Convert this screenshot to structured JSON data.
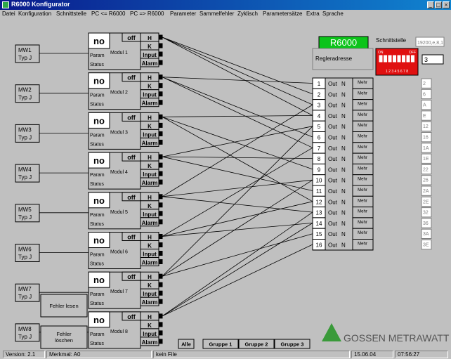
{
  "window": {
    "title": "R6000 Konfigurator"
  },
  "menu": [
    "Datei",
    "Konfiguration",
    "Schnittstelle",
    "PC <= R6000",
    "PC => R6000",
    "Parameter",
    "Sammelfehler",
    "Zyklisch",
    "Parametersätze",
    "Extra",
    "Sprache"
  ],
  "sensors": [
    {
      "name": "MW1",
      "type": "Typ J"
    },
    {
      "name": "MW2",
      "type": "Typ J"
    },
    {
      "name": "MW3",
      "type": "Typ J"
    },
    {
      "name": "MW4",
      "type": "Typ J"
    },
    {
      "name": "MW5",
      "type": "Typ J"
    },
    {
      "name": "MW6",
      "type": "Typ J"
    },
    {
      "name": "MW7",
      "type": "Typ J"
    },
    {
      "name": "MW8",
      "type": "Typ J"
    }
  ],
  "modules": [
    {
      "label": "Modul 1",
      "state": "no"
    },
    {
      "label": "Modul 2",
      "state": "no"
    },
    {
      "label": "Modul 3",
      "state": "no"
    },
    {
      "label": "Modul 4",
      "state": "no"
    },
    {
      "label": "Modul 5",
      "state": "no"
    },
    {
      "label": "Modul 6",
      "state": "no"
    },
    {
      "label": "Modul 7",
      "state": "no"
    },
    {
      "label": "Modul 8",
      "state": "no"
    }
  ],
  "module_labels": {
    "param": "Param",
    "status": "Status",
    "off": "off",
    "h": "H",
    "k": "K",
    "input": "Input",
    "alarm": "Alarm"
  },
  "device": {
    "name": "R6000",
    "address_label": "Regleradresse",
    "interface_label": "Schnittstelle",
    "interface_value": "19200,e,8,1",
    "address_value": "3",
    "dip_on": "ON",
    "dip_off": "OFF",
    "dip_numbers": "1 2 3 4 5 6 7 8"
  },
  "outputs": {
    "out": "Out",
    "n": "N",
    "mehr": "Mehr",
    "numbers": [
      "1",
      "2",
      "3",
      "4",
      "5",
      "6",
      "7",
      "8",
      "9",
      "10",
      "11",
      "12",
      "13",
      "14",
      "15",
      "16"
    ]
  },
  "hex_codes": [
    "2",
    "6",
    "A",
    "E",
    "12",
    "16",
    "1A",
    "1E",
    "22",
    "26",
    "2A",
    "2E",
    "32",
    "36",
    "3A",
    "3E"
  ],
  "connections": [
    [
      0,
      1
    ],
    [
      0,
      3
    ],
    [
      0,
      2
    ],
    [
      1,
      0
    ],
    [
      1,
      6
    ],
    [
      1,
      5
    ],
    [
      2,
      3
    ],
    [
      2,
      8
    ],
    [
      2,
      11
    ],
    [
      3,
      4
    ],
    [
      3,
      10
    ],
    [
      3,
      7
    ],
    [
      4,
      2
    ],
    [
      4,
      12
    ],
    [
      4,
      9
    ],
    [
      5,
      11
    ],
    [
      5,
      13
    ],
    [
      5,
      6
    ],
    [
      6,
      9
    ],
    [
      6,
      14
    ],
    [
      6,
      4
    ],
    [
      7,
      15
    ],
    [
      7,
      12
    ],
    [
      7,
      13
    ]
  ],
  "buttons": {
    "fehler_lesen": "Fehler lesen",
    "fehler_loeschen_1": "Fehler",
    "fehler_loeschen_2": "löschen",
    "alle": "Alle",
    "gruppe1": "Gruppe 1",
    "gruppe2": "Gruppe 2",
    "gruppe3": "Gruppe 3"
  },
  "logo": "GOSSEN METRAWATT",
  "status": {
    "version": "Version: 2.1",
    "merkmal": "Merkmal: A0",
    "file": "kein File",
    "date": "15.06.04",
    "time": "07:56:27"
  }
}
